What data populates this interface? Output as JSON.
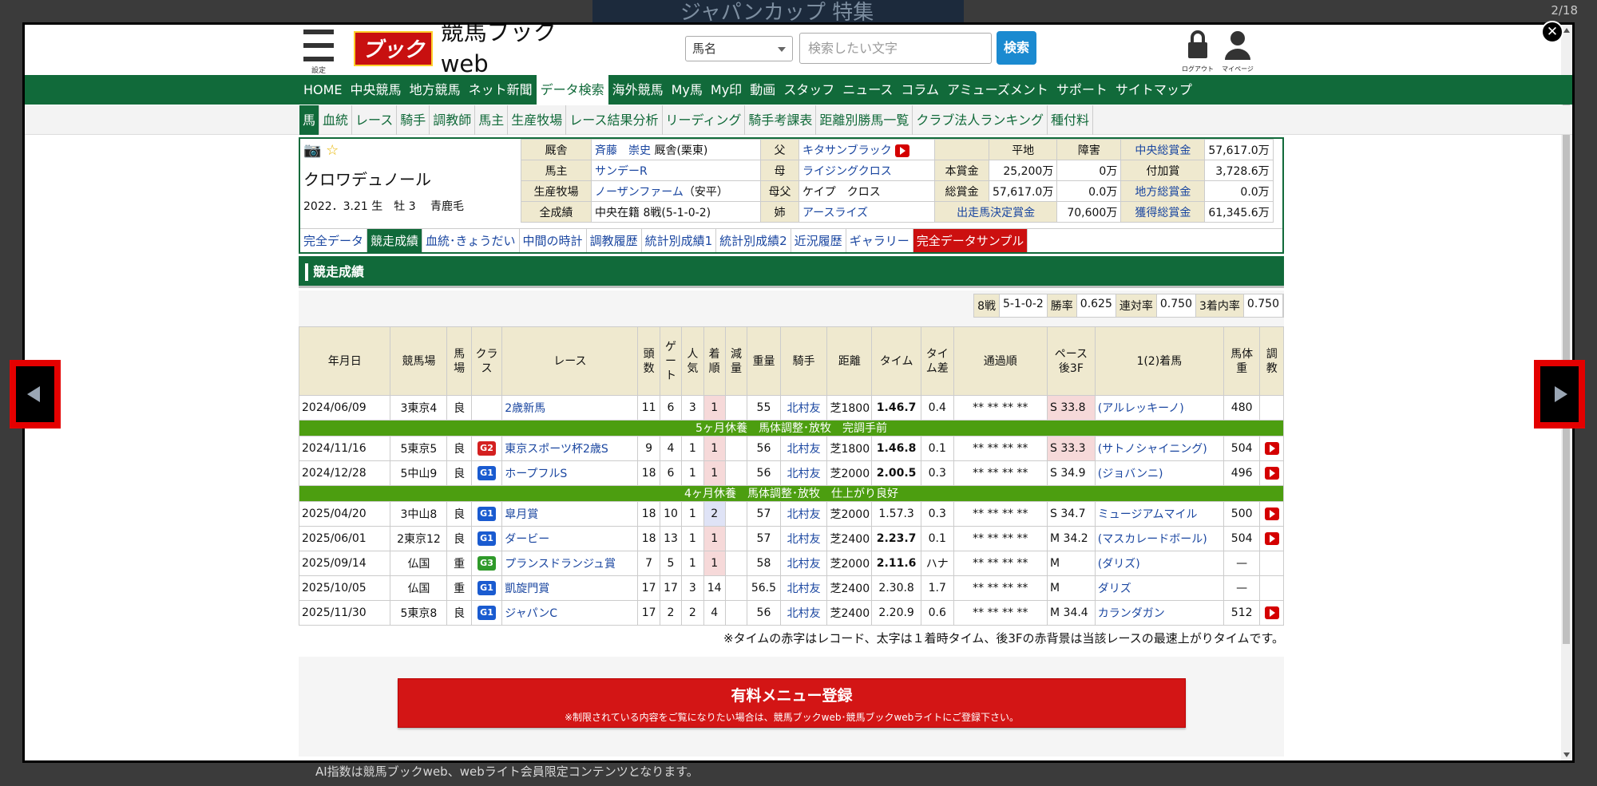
{
  "background": {
    "top_banner": "ジャパンカップ 特集",
    "bottom_text": "AI指数は競馬ブックweb、webライト会員限定コンテンツとなります。"
  },
  "viewer": {
    "counter": "2/18",
    "close": "✕"
  },
  "header": {
    "menu_caption": "設定",
    "logo_mark": "ブック",
    "logo_text": "競馬ブックweb",
    "select_value": "馬名",
    "search_placeholder": "検索したい文字",
    "search_button": "検索",
    "logout": "ログアウト",
    "mypage": "マイページ"
  },
  "main_nav": [
    "HOME",
    "中央競馬",
    "地方競馬",
    "ネット新聞",
    "データ検索",
    "海外競馬",
    "My馬",
    "My印",
    "動画",
    "スタッフ",
    "ニュース",
    "コラム",
    "アミューズメント",
    "サポート",
    "サイトマップ"
  ],
  "sub_nav": [
    "馬",
    "血統",
    "レース",
    "騎手",
    "調教師",
    "馬主",
    "生産牧場",
    "レース結果分析",
    "リーディング",
    "騎手考課表",
    "距離別勝馬一覧",
    "クラブ法人ランキング",
    "種付料"
  ],
  "horse": {
    "name": "クロワデュノール",
    "meta": "2022．3.21 生　牡 3　 青鹿毛",
    "rows": [
      [
        "厩舎",
        "斉藤　崇史",
        "厩舎(栗東)",
        "父",
        "キタサンブラック",
        "",
        "平地",
        "障害",
        "中央総賞金",
        "57,617.0万"
      ],
      [
        "馬主",
        "サンデーR",
        "",
        "母",
        "ライジングクロス",
        "本賞金",
        "25,200万",
        "0万",
        "付加賞",
        "3,728.6万"
      ],
      [
        "生産牧場",
        "ノーザンファーム",
        "（安平）",
        "母父",
        "ケイプ　クロス",
        "総賞金",
        "57,617.0万",
        "0.0万",
        "地方総賞金",
        "0.0万"
      ],
      [
        "全成績",
        "中央在籍 8戦(5-1-0-2)",
        "",
        "姉",
        "アースライズ",
        "出走馬決定賞金",
        "",
        "70,600万",
        "獲得総賞金",
        "61,345.6万"
      ]
    ]
  },
  "tabs": [
    "完全データ",
    "競走成績",
    "血統･きょうだい",
    "中間の時計",
    "調教履歴",
    "統計別成績1",
    "統計別成績2",
    "近況履歴",
    "ギャラリー",
    "完全データサンプル"
  ],
  "section_title": "競走成績",
  "stats": [
    "8戦",
    "5-1-0-2",
    "勝率",
    "0.625",
    "連対率",
    "0.750",
    "3着内率",
    "0.750"
  ],
  "results_headers": [
    "年月日",
    "競馬場",
    "馬場",
    "クラス",
    "レース",
    "頭数",
    "ゲート",
    "人気",
    "着順",
    "減量",
    "重量",
    "騎手",
    "距離",
    "タイム",
    "タイム差",
    "通過順",
    "ペース後3F",
    "1(2)着馬",
    "馬体重",
    "調教"
  ],
  "results": [
    {
      "date": "2024/06/09",
      "course": "3東京4",
      "cond": "良",
      "grade": "",
      "race": "2歳新馬",
      "heads": "11",
      "gate": "6",
      "pop": "3",
      "rank": "1",
      "red": "",
      "wt": "55",
      "jockey": "北村友",
      "dist": "芝1800",
      "time": "1.46.7",
      "diff": "0.4",
      "pass": "** ** ** **",
      "pace": "S 33.8",
      "winner": "(アルレッキーノ)",
      "bw": "480",
      "video": false
    },
    {
      "rest": "5ヶ月休養　馬体調整･放牧　完調手前"
    },
    {
      "date": "2024/11/16",
      "course": "5東京5",
      "cond": "良",
      "grade": "G2",
      "race": "東京スポーツ杯2歳S",
      "heads": "9",
      "gate": "4",
      "pop": "1",
      "rank": "1",
      "red": "",
      "wt": "56",
      "jockey": "北村友",
      "dist": "芝1800",
      "time": "1.46.8",
      "diff": "0.1",
      "pass": "** ** ** **",
      "pace": "S 33.3",
      "winner": "(サトノシャイニング)",
      "bw": "504",
      "video": true
    },
    {
      "date": "2024/12/28",
      "course": "5中山9",
      "cond": "良",
      "grade": "G1",
      "race": "ホープフルS",
      "heads": "18",
      "gate": "6",
      "pop": "1",
      "rank": "1",
      "red": "",
      "wt": "56",
      "jockey": "北村友",
      "dist": "芝2000",
      "time": "2.00.5",
      "diff": "0.3",
      "pass": "** ** ** **",
      "pace": "S 34.9",
      "winner": "(ジョバンニ)",
      "bw": "496",
      "video": true
    },
    {
      "rest": "4ヶ月休養　馬体調整･放牧　仕上がり良好"
    },
    {
      "date": "2025/04/20",
      "course": "3中山8",
      "cond": "良",
      "grade": "G1",
      "race": "皐月賞",
      "heads": "18",
      "gate": "10",
      "pop": "1",
      "rank": "2",
      "red": "",
      "wt": "57",
      "jockey": "北村友",
      "dist": "芝2000",
      "time": "1.57.3",
      "diff": "0.3",
      "pass": "** ** ** **",
      "pace": "S 34.7",
      "winner": "ミュージアムマイル",
      "bw": "500",
      "video": true
    },
    {
      "date": "2025/06/01",
      "course": "2東京12",
      "cond": "良",
      "grade": "G1",
      "race": "ダービー",
      "heads": "18",
      "gate": "13",
      "pop": "1",
      "rank": "1",
      "red": "",
      "wt": "57",
      "jockey": "北村友",
      "dist": "芝2400",
      "time": "2.23.7",
      "diff": "0.1",
      "pass": "** ** ** **",
      "pace": "M 34.2",
      "winner": "(マスカレードボール)",
      "bw": "504",
      "video": true
    },
    {
      "date": "2025/09/14",
      "course": "仏国",
      "cond": "重",
      "grade": "G3",
      "race": "プランスドランジュ賞",
      "heads": "7",
      "gate": "5",
      "pop": "1",
      "rank": "1",
      "red": "",
      "wt": "58",
      "jockey": "北村友",
      "dist": "芝2000",
      "time": "2.11.6",
      "diff": "ハナ",
      "pass": "** ** ** **",
      "pace": "M",
      "winner": "(ダリズ)",
      "bw": "—",
      "video": false
    },
    {
      "date": "2025/10/05",
      "course": "仏国",
      "cond": "重",
      "grade": "G1",
      "race": "凱旋門賞",
      "heads": "17",
      "gate": "17",
      "pop": "3",
      "rank": "14",
      "red": "",
      "wt": "56.5",
      "jockey": "北村友",
      "dist": "芝2400",
      "time": "2.30.8",
      "diff": "1.7",
      "pass": "** ** ** **",
      "pace": "M",
      "winner": "ダリズ",
      "bw": "—",
      "video": false
    },
    {
      "date": "2025/11/30",
      "course": "5東京8",
      "cond": "良",
      "grade": "G1",
      "race": "ジャパンC",
      "heads": "17",
      "gate": "2",
      "pop": "2",
      "rank": "4",
      "red": "",
      "wt": "56",
      "jockey": "北村友",
      "dist": "芝2400",
      "time": "2.20.9",
      "diff": "0.6",
      "pass": "** ** ** **",
      "pace": "M 34.4",
      "winner": "カランダガン",
      "bw": "512",
      "video": true
    }
  ],
  "note": "※タイムの赤字はレコード、太字は１着時タイム、後3Fの赤背景は当該レースの最速上がりタイムです。",
  "paid": {
    "title": "有料メニュー登録",
    "sub": "※制限されている内容をご覧になりたい場合は、競馬ブックweb･競馬ブックwebライトにご登録下さい。"
  }
}
